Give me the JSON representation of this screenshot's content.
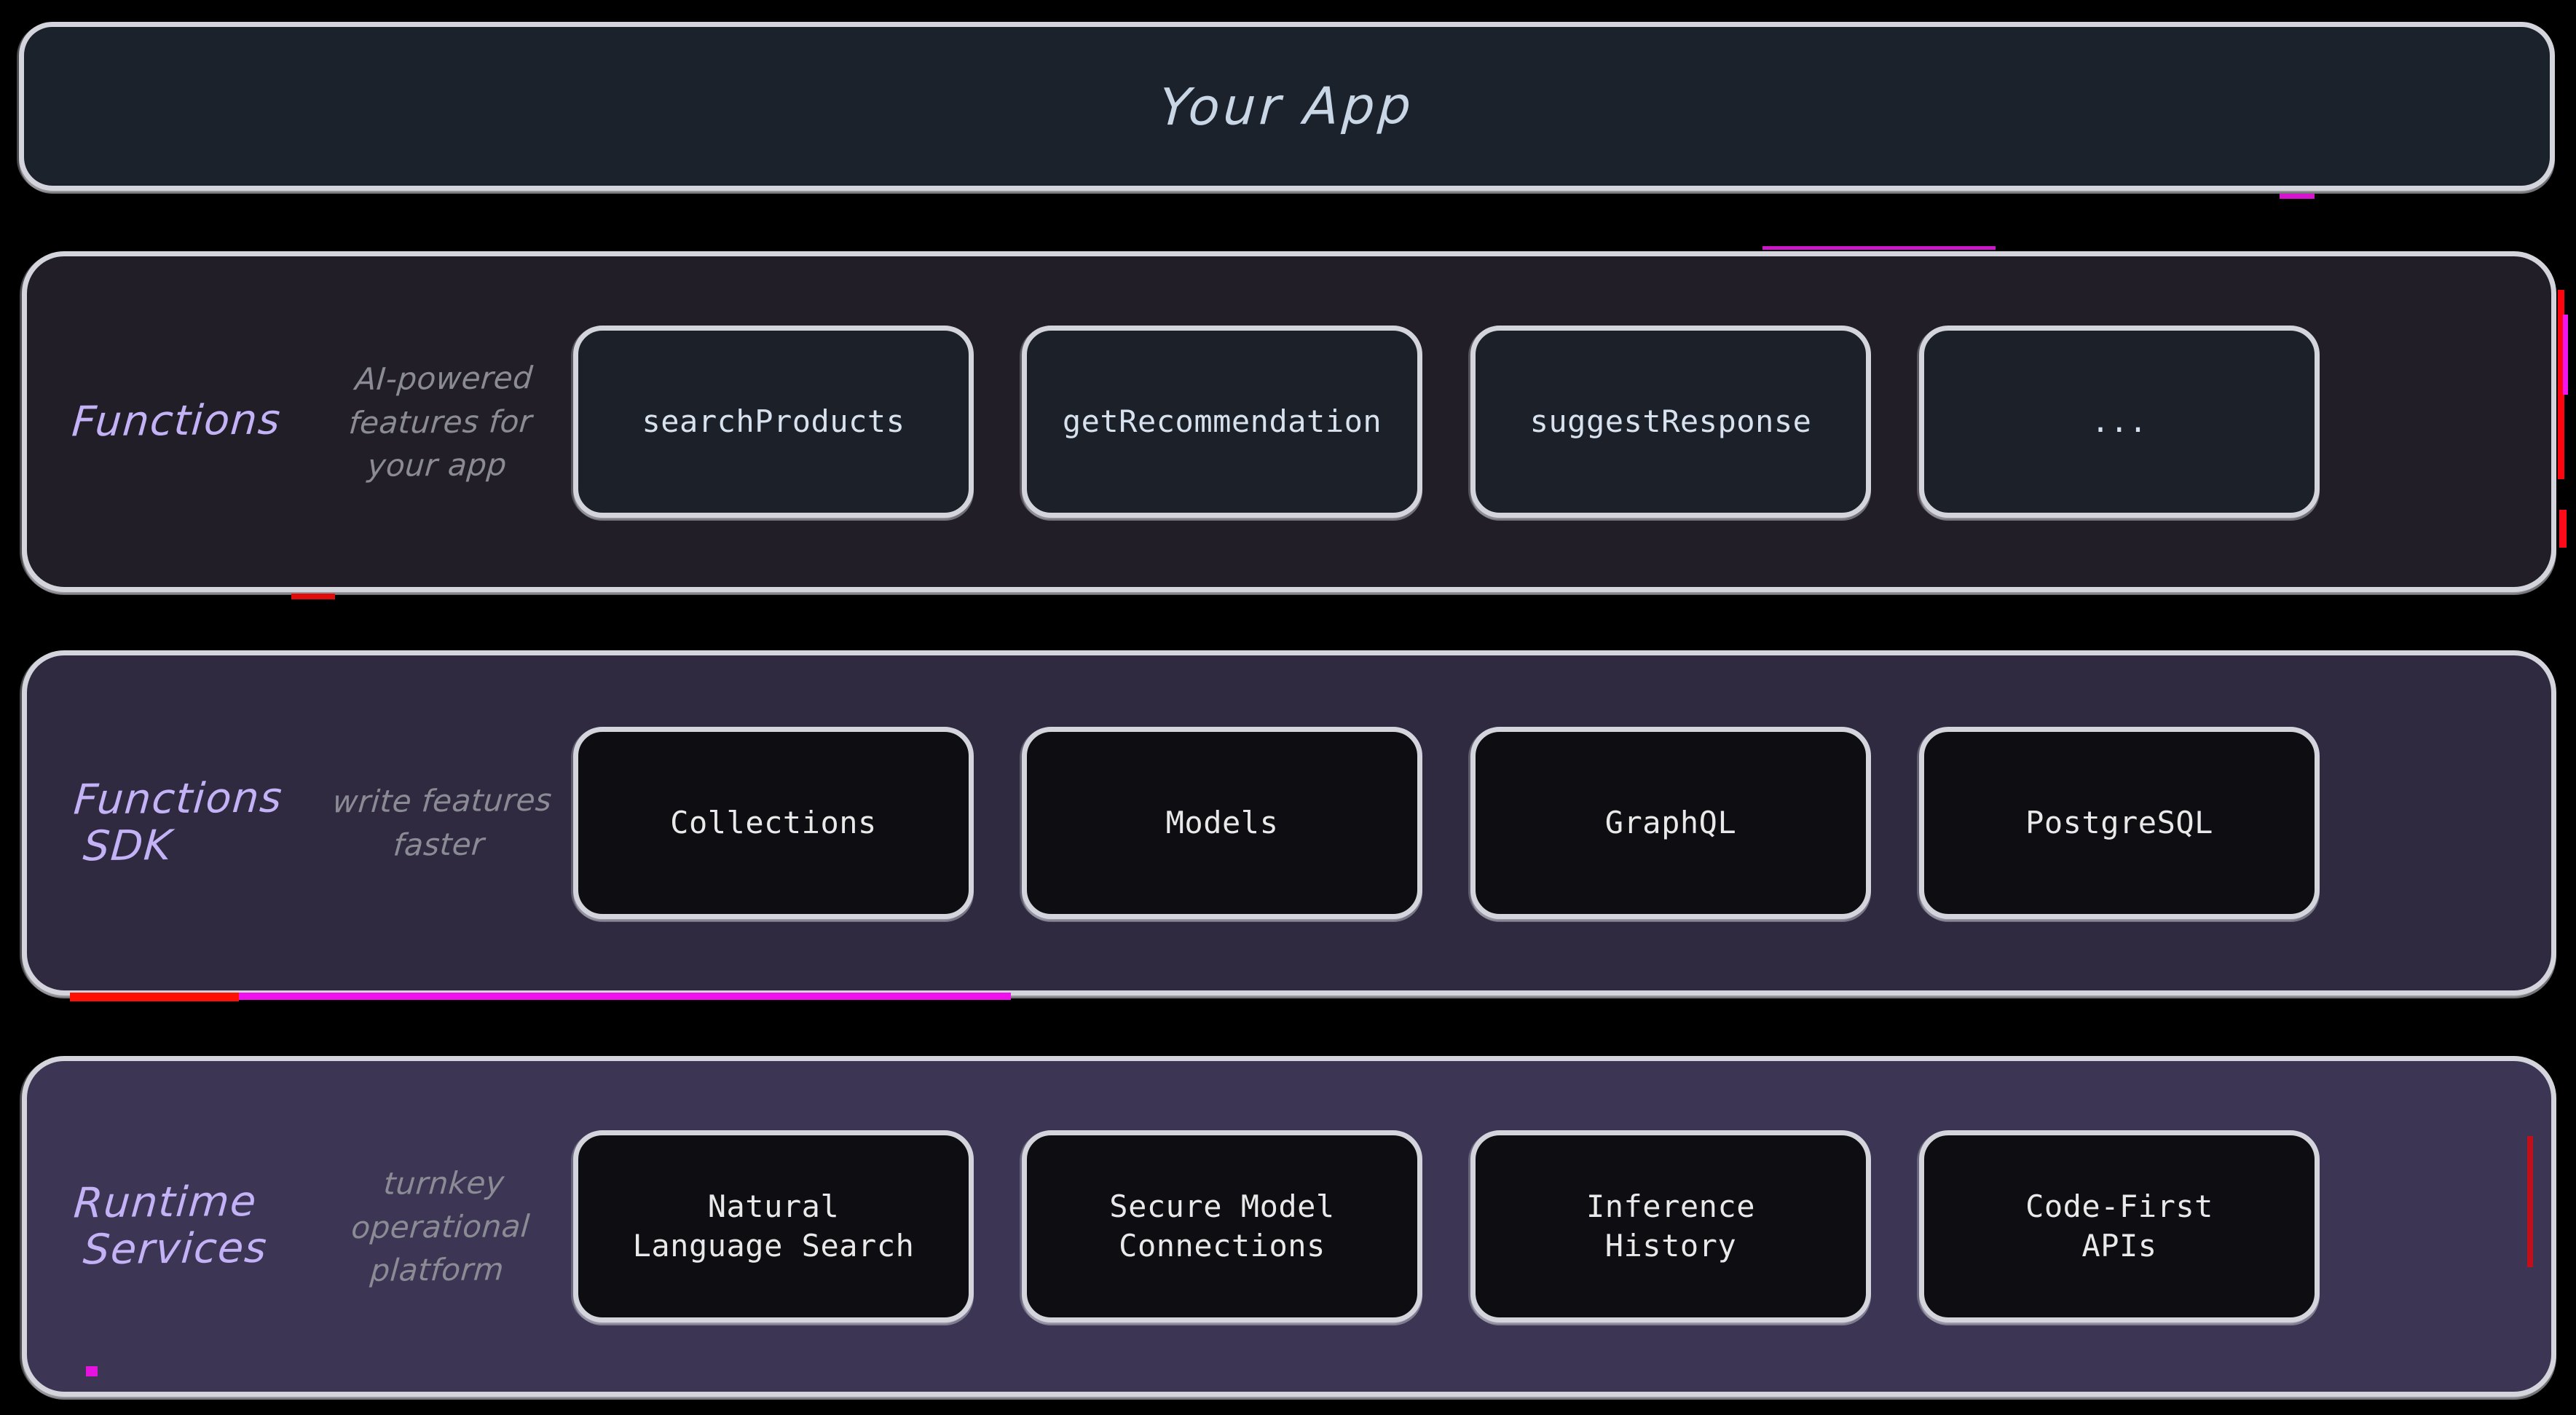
{
  "app": {
    "title": "Your App"
  },
  "layers": [
    {
      "id": "functions",
      "name": "Functions",
      "name_line2": "",
      "tagline": "AI-powered features for your app",
      "accent": "#c4b2f7",
      "background": "#211e28",
      "chip_style": "navy",
      "chips": [
        {
          "line1": "searchProducts",
          "line2": ""
        },
        {
          "line1": "getRecommendation",
          "line2": ""
        },
        {
          "line1": "suggestResponse",
          "line2": ""
        },
        {
          "line1": "...",
          "line2": ""
        }
      ]
    },
    {
      "id": "sdk",
      "name": "Functions",
      "name_line2": "SDK",
      "tagline": "write features faster",
      "accent": "#c4b2f7",
      "background": "#2f2a40",
      "chip_style": "dark",
      "chips": [
        {
          "line1": "Collections",
          "line2": ""
        },
        {
          "line1": "Models",
          "line2": ""
        },
        {
          "line1": "GraphQL",
          "line2": ""
        },
        {
          "line1": "PostgreSQL",
          "line2": ""
        }
      ]
    },
    {
      "id": "runtime",
      "name": "Runtime",
      "name_line2": "Services",
      "tagline": "turnkey operational platform",
      "accent": "#c4b2f7",
      "background": "#3c3553",
      "chip_style": "dark",
      "chips": [
        {
          "line1": "Natural",
          "line2": "Language Search"
        },
        {
          "line1": "Secure Model",
          "line2": "Connections"
        },
        {
          "line1": "Inference",
          "line2": "History"
        },
        {
          "line1": "Code-First",
          "line2": "APIs"
        }
      ]
    }
  ],
  "colors": {
    "page_background": "#000000",
    "border": "#d4d4dd",
    "app_box_fill": "#1c222c",
    "app_title_text": "#c9d6e6",
    "tagline_text": "#8b8b95",
    "chip_navy_fill": "#1b2029",
    "chip_dark_fill": "#0e0e12",
    "chip_text": "#dfe6ef"
  }
}
